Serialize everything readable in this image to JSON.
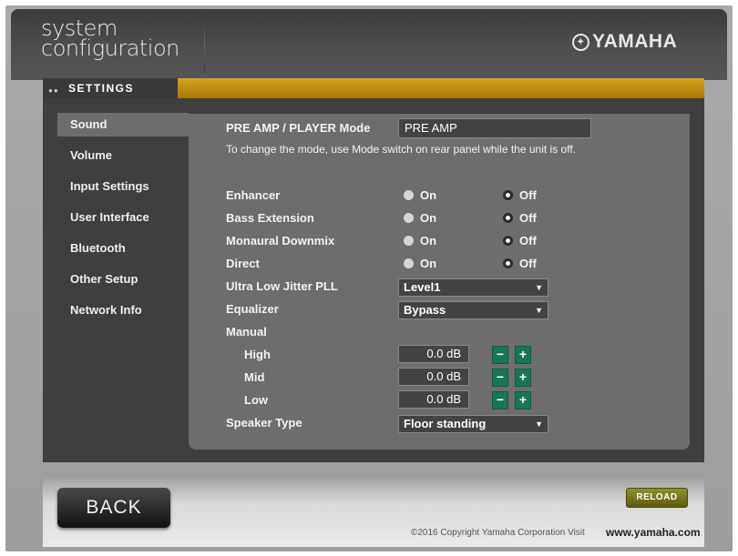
{
  "header": {
    "title_line1": "system",
    "title_line2": "configuration",
    "brand": "YAMAHA",
    "brand_emblem_icon": "tuning-forks-emblem-icon",
    "tab_label": "SETTINGS"
  },
  "sidebar": {
    "items": [
      {
        "label": "Sound",
        "active": true
      },
      {
        "label": "Volume"
      },
      {
        "label": "Input Settings"
      },
      {
        "label": "User Interface"
      },
      {
        "label": "Bluetooth"
      },
      {
        "label": "Other Setup"
      },
      {
        "label": "Network Info"
      }
    ]
  },
  "content": {
    "mode_label": "PRE AMP / PLAYER Mode",
    "mode_value": "PRE AMP",
    "mode_note": "To change the mode, use Mode switch on rear panel while the unit is off.",
    "on_label": "On",
    "off_label": "Off",
    "toggles": [
      {
        "label": "Enhancer",
        "value": "Off"
      },
      {
        "label": "Bass Extension",
        "value": "Off"
      },
      {
        "label": "Monaural Downmix",
        "value": "Off"
      },
      {
        "label": "Direct",
        "value": "Off"
      }
    ],
    "ulj_label": "Ultra Low Jitter PLL",
    "ulj_value": "Level1",
    "eq_label": "Equalizer",
    "eq_value": "Bypass",
    "manual_label": "Manual",
    "bands": [
      {
        "label": "High",
        "value": "0.0 dB"
      },
      {
        "label": "Mid",
        "value": "0.0 dB"
      },
      {
        "label": "Low",
        "value": "0.0 dB"
      }
    ],
    "minus": "−",
    "plus": "+",
    "speaker_label": "Speaker Type",
    "speaker_value": "Floor standing",
    "caret": "▼"
  },
  "footer": {
    "back_label": "BACK",
    "reload_label": "RELOAD",
    "copyright": "©2016 Copyright Yamaha Corporation Visit",
    "site": "www.yamaha.com"
  },
  "colors": {
    "accent_gold": "#c8940e",
    "step_button_green": "#187557",
    "reload_olive": "#7a7a1e"
  }
}
